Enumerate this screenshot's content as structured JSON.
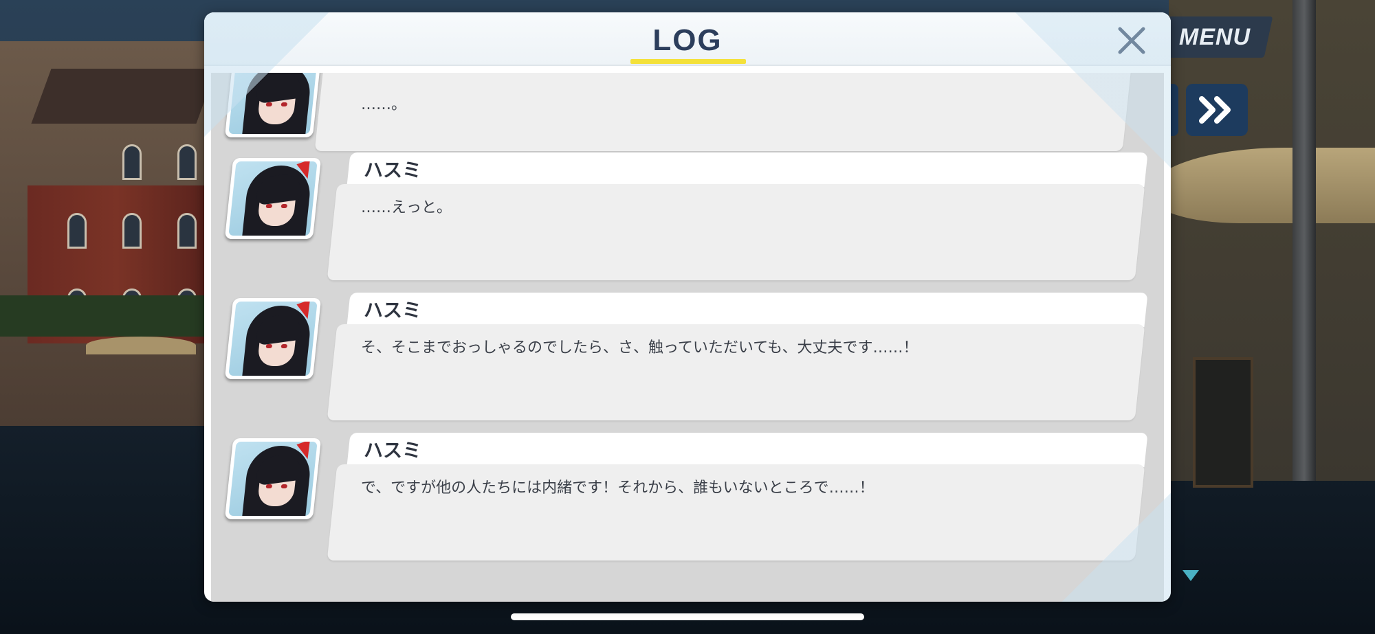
{
  "hud": {
    "menu_label": "MENU",
    "skip_icon": "double-chevron-right-icon"
  },
  "dialog": {
    "title": "LOG",
    "close_icon": "close-icon"
  },
  "entries": [
    {
      "speaker": "",
      "text": "……。"
    },
    {
      "speaker": "ハスミ",
      "text": "……えっと。"
    },
    {
      "speaker": "ハスミ",
      "text": "そ、そこまでおっしゃるのでしたら、さ、触っていただいても、大丈夫です……！"
    },
    {
      "speaker": "ハスミ",
      "text": "で、ですが他の人たちには内緒です！それから、誰もいないところで……！"
    }
  ],
  "colors": {
    "title": "#2c3e5c",
    "title_underline": "#f4e13a",
    "menu_bg": "#2c3a4c",
    "skip_bg": "#1d3b5e"
  }
}
